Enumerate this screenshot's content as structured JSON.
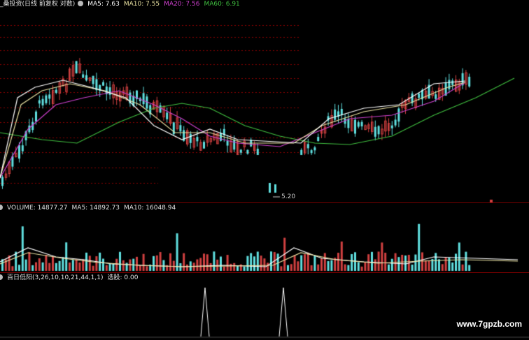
{
  "main_panel": {
    "title": "_桑投资(日线 前复权 对数)",
    "ma5": "MA5: 7.63",
    "ma10": "MA10: 7.55",
    "ma20": "MA20: 7.56",
    "ma60": "MA60: 6.91",
    "low_marker": "5.20",
    "colors": {
      "ma5": "#ffffff",
      "ma10": "#e8e0a0",
      "ma20": "#d040d0",
      "ma60": "#40c040",
      "up": "#d04040",
      "down": "#60e0e0",
      "grid": "#8b0000"
    }
  },
  "volume_panel": {
    "volume": "VOLUME: 14877.27",
    "ma5": "MA5: 14892.73",
    "ma10": "MA10: 16048.94"
  },
  "indicator_panel": {
    "name": "百日低阳(3,26,10,10,21,44,1,1)",
    "value": "选股: 0.00"
  },
  "watermark": "www.7gpzb.com"
}
